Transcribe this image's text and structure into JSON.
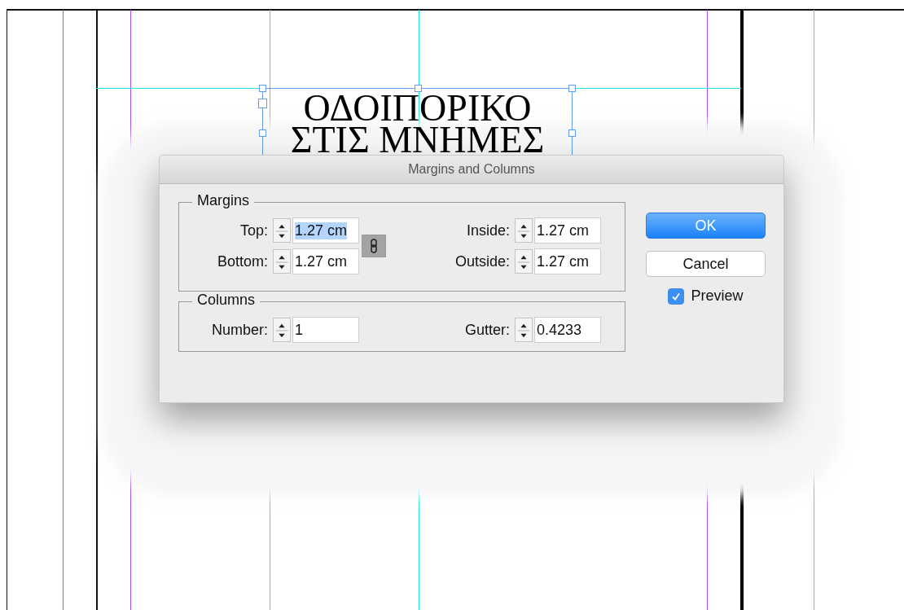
{
  "canvas": {
    "title_lines": [
      "ΟΔΟΙΠΟΡΙΚΟ",
      "ΣΤΙΣ ΜΝΗΜΕΣ"
    ]
  },
  "dialog": {
    "title": "Margins and Columns",
    "groups": [
      {
        "legend": "Margins",
        "link": {
          "on": true
        },
        "fields": [
          {
            "label": "Top:",
            "value": "1.27 cm",
            "selected": true
          },
          {
            "label": "Inside:",
            "value": "1.27 cm",
            "selected": false
          },
          {
            "label": "Bottom:",
            "value": "1.27 cm",
            "selected": false
          },
          {
            "label": "Outside:",
            "value": "1.27 cm",
            "selected": false
          }
        ]
      },
      {
        "legend": "Columns",
        "fields": [
          {
            "label": "Number:",
            "value": "1",
            "selected": false
          },
          {
            "label": "Gutter:",
            "value": "0.4233",
            "selected": false
          }
        ]
      }
    ],
    "buttons": [
      {
        "label": "OK",
        "kind": "default"
      },
      {
        "label": "Cancel",
        "kind": "normal"
      }
    ],
    "preview": {
      "label": "Preview",
      "checked": true
    }
  }
}
